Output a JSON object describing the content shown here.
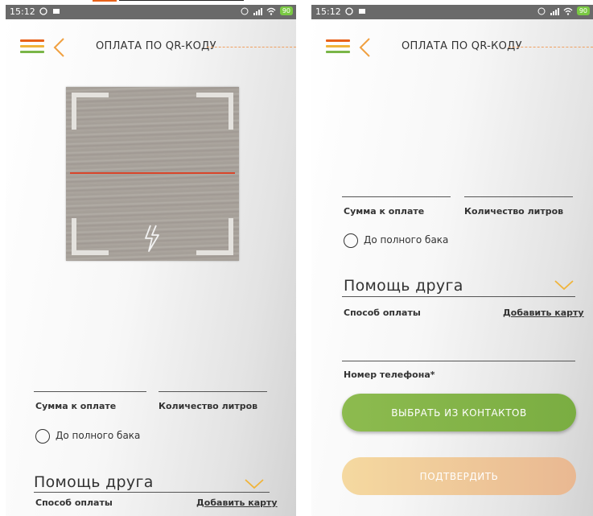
{
  "colors": {
    "accent_orange": "#e8621a",
    "accent_yellow": "#f0b43a",
    "accent_green": "#7ab648",
    "button_green": "#8dbb4f",
    "button_disabled": "#f5d9a0",
    "scan_line": "#d9452a"
  },
  "screens": [
    {
      "status": {
        "time": "15:12",
        "battery": "90"
      },
      "title": "ОПЛАТА ПО QR-КОДУ",
      "amount_label": "Сумма к оплате",
      "liters_label": "Количество литров",
      "full_tank_label": "До полного бака",
      "friend_help": "Помощь друга",
      "payment_method_label": "Способ оплаты",
      "add_card_link": "Добавить карту",
      "icons": [
        "menu-icon",
        "back-chevron-icon",
        "flash-icon",
        "chevron-down-icon"
      ]
    },
    {
      "status": {
        "time": "15:12",
        "battery": "90"
      },
      "title": "ОПЛАТА ПО QR-КОДУ",
      "amount_label": "Сумма к оплате",
      "liters_label": "Количество литров",
      "full_tank_label": "До полного бака",
      "friend_help": "Помощь друга",
      "payment_method_label": "Способ оплаты",
      "add_card_link": "Добавить карту",
      "phone_label": "Номер телефона*",
      "contacts_button": "ВЫБРАТЬ ИЗ КОНТАКТОВ",
      "confirm_button": "ПОДТВЕРДИТЬ",
      "icons": [
        "menu-icon",
        "back-chevron-icon",
        "chevron-down-icon"
      ]
    }
  ]
}
